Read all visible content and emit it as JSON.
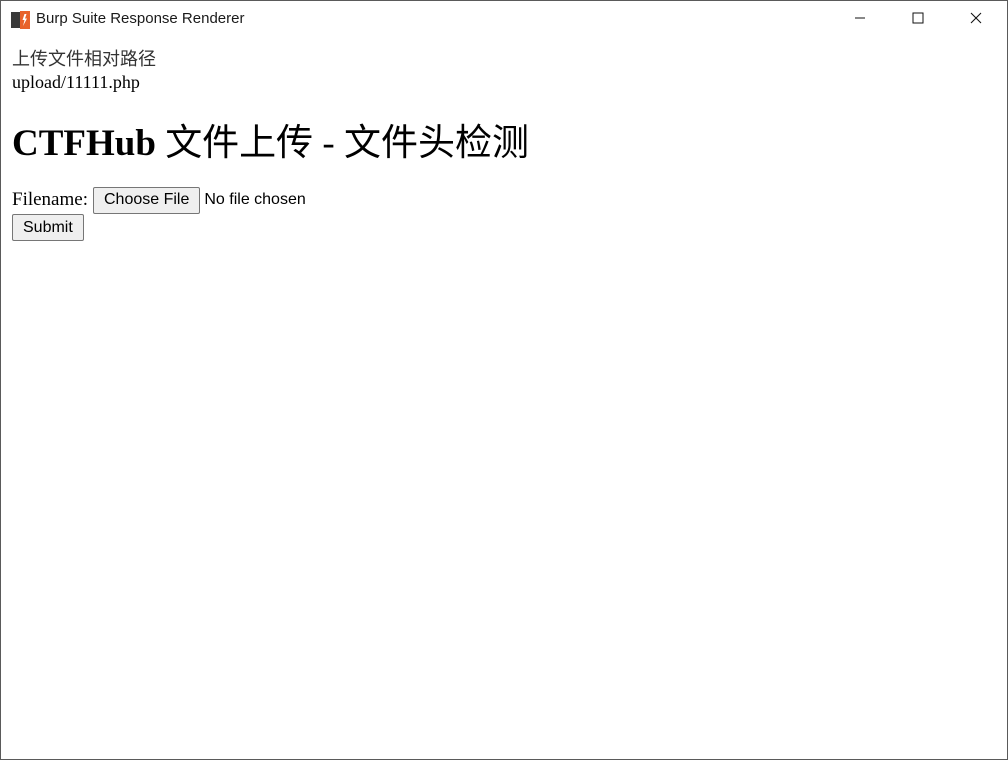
{
  "window": {
    "title": "Burp Suite Response Renderer",
    "icon": "burp-suite-logo-icon",
    "controls": [
      "minimize-icon",
      "maximize-icon",
      "close-icon"
    ]
  },
  "page": {
    "path_label": "上传文件相对路径",
    "path_value": "upload/11111.php",
    "heading_latin": "CTFHub ",
    "heading_cjk": "文件上传 - 文件头检测",
    "form": {
      "filename_label": "Filename:",
      "choose_file_label": "Choose File",
      "no_file_text": "No file chosen",
      "submit_label": "Submit"
    }
  },
  "colors": {
    "logo_orange": "#e8622a",
    "logo_dark": "#3a3a3a"
  }
}
